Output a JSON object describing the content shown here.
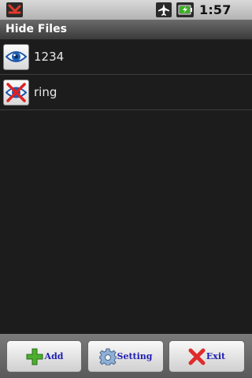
{
  "status_bar": {
    "time": "1:57 PM",
    "icons": [
      "missed-notification-icon",
      "airplane-mode-icon",
      "battery-charging-icon"
    ]
  },
  "title_bar": {
    "title": "Hide Files"
  },
  "list": {
    "items": [
      {
        "label": "1234",
        "icon": "eye-icon",
        "hidden": false
      },
      {
        "label": "ring",
        "icon": "eye-crossed-icon",
        "hidden": true
      }
    ]
  },
  "toolbar": {
    "add_label": "Add",
    "setting_label": "Setting",
    "exit_label": "Exit"
  },
  "colors": {
    "button_text": "#1f1fb0",
    "list_background": "#1c1c1c",
    "title_background": "#4a4a4a"
  }
}
